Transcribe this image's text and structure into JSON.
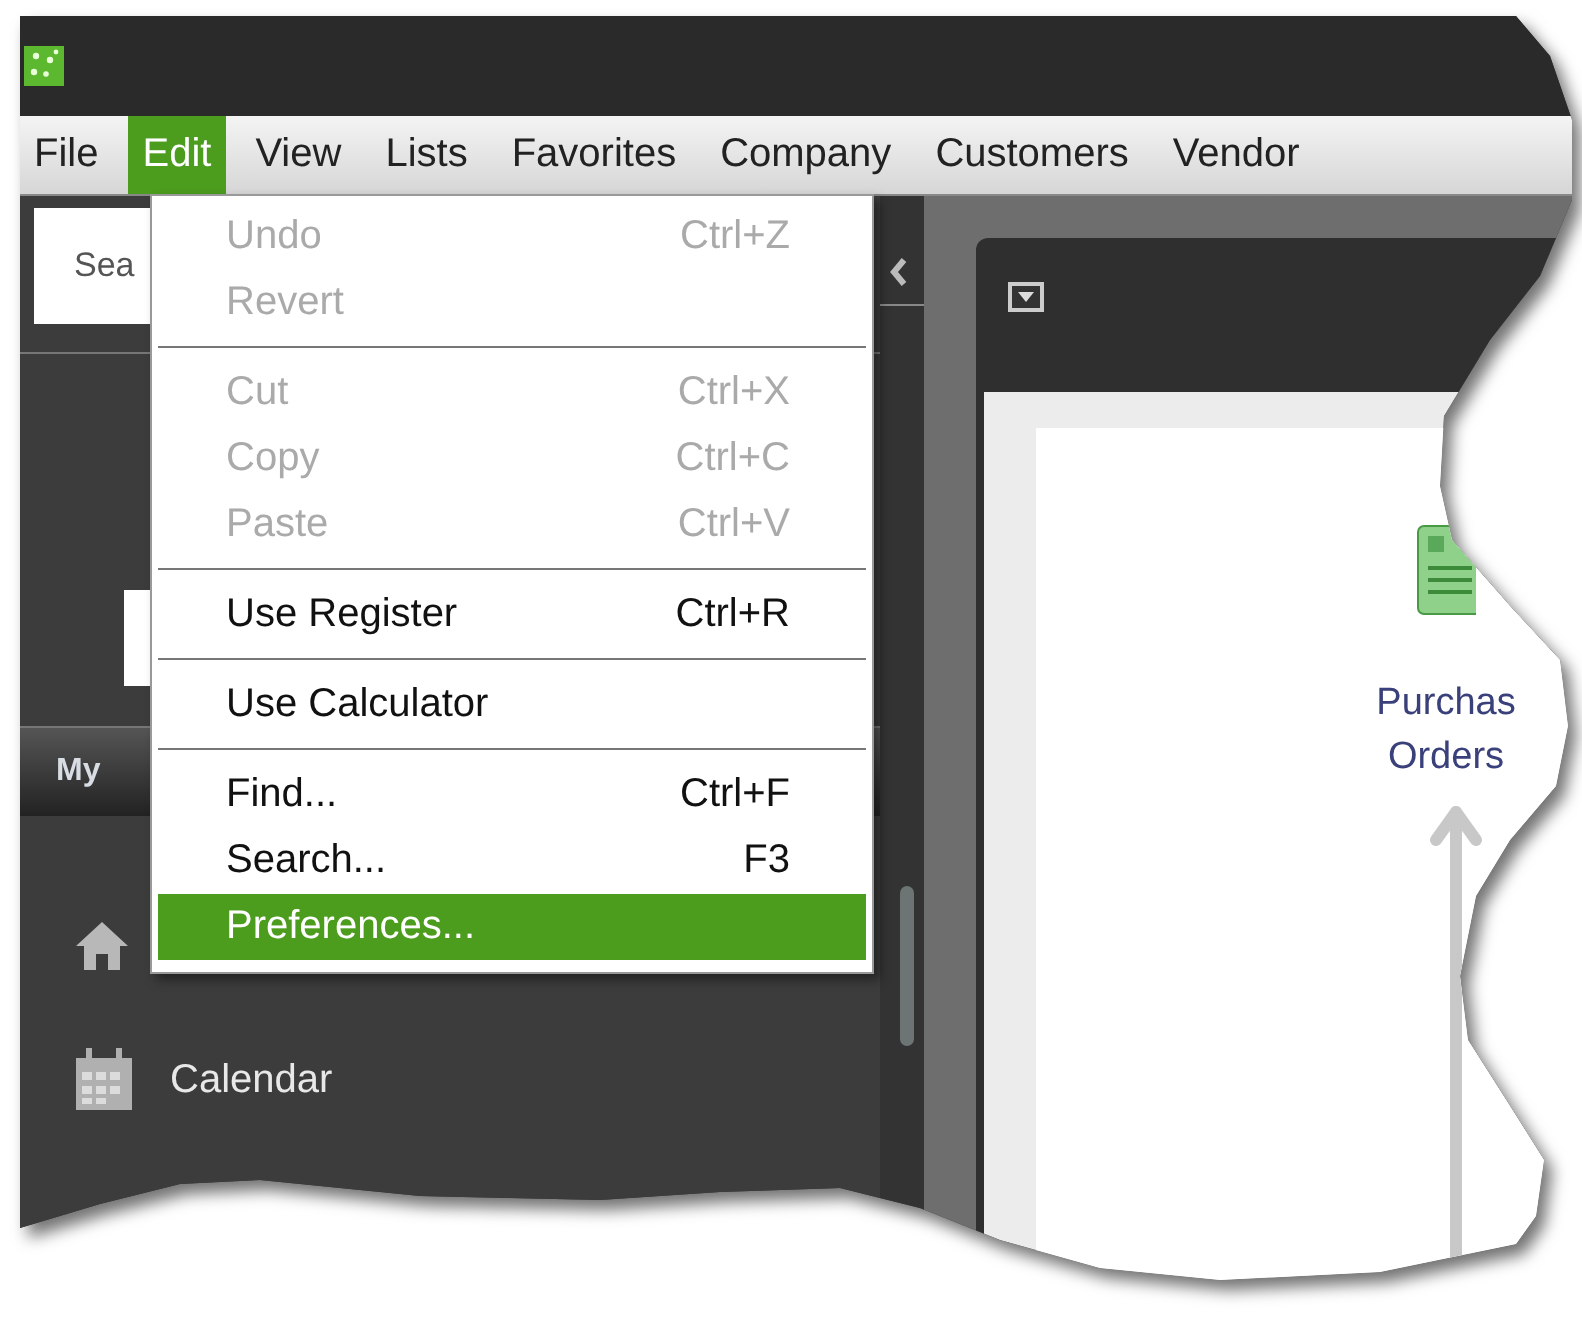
{
  "menu_bar": [
    {
      "label": "File",
      "selected": false
    },
    {
      "label": "Edit",
      "selected": true
    },
    {
      "label": "View",
      "selected": false
    },
    {
      "label": "Lists",
      "selected": false
    },
    {
      "label": "Favorites",
      "selected": false
    },
    {
      "label": "Company",
      "selected": false
    },
    {
      "label": "Customers",
      "selected": false
    },
    {
      "label": "Vendor",
      "selected": false
    }
  ],
  "sidebar": {
    "search": {
      "placeholder": "Sea"
    },
    "section_header": "My",
    "items": [
      {
        "kind": "home"
      },
      {
        "kind": "calendar",
        "label": "Calendar"
      }
    ]
  },
  "edit_menu": [
    {
      "kind": "item",
      "label": "Undo",
      "shortcut": "Ctrl+Z",
      "disabled": true,
      "selected": false
    },
    {
      "kind": "item",
      "label": "Revert",
      "disabled": true,
      "selected": false
    },
    {
      "kind": "separator"
    },
    {
      "kind": "item",
      "label": "Cut",
      "shortcut": "Ctrl+X",
      "disabled": true,
      "selected": false
    },
    {
      "kind": "item",
      "label": "Copy",
      "shortcut": "Ctrl+C",
      "disabled": true,
      "selected": false
    },
    {
      "kind": "item",
      "label": "Paste",
      "shortcut": "Ctrl+V",
      "disabled": true,
      "selected": false
    },
    {
      "kind": "separator"
    },
    {
      "kind": "item",
      "label": "Use Register",
      "shortcut": "Ctrl+R",
      "disabled": false,
      "selected": false
    },
    {
      "kind": "separator"
    },
    {
      "kind": "item",
      "label": "Use Calculator",
      "disabled": false,
      "selected": false
    },
    {
      "kind": "separator"
    },
    {
      "kind": "item",
      "label": "Find...",
      "shortcut": "Ctrl+F",
      "disabled": false,
      "selected": false
    },
    {
      "kind": "item",
      "label": "Search...",
      "shortcut": "F3",
      "disabled": false,
      "selected": false
    },
    {
      "kind": "item",
      "label": "Preferences...",
      "disabled": false,
      "selected": true
    }
  ],
  "main": {
    "flow_node": {
      "label_lines": [
        "Purchas",
        "Orders"
      ]
    }
  }
}
